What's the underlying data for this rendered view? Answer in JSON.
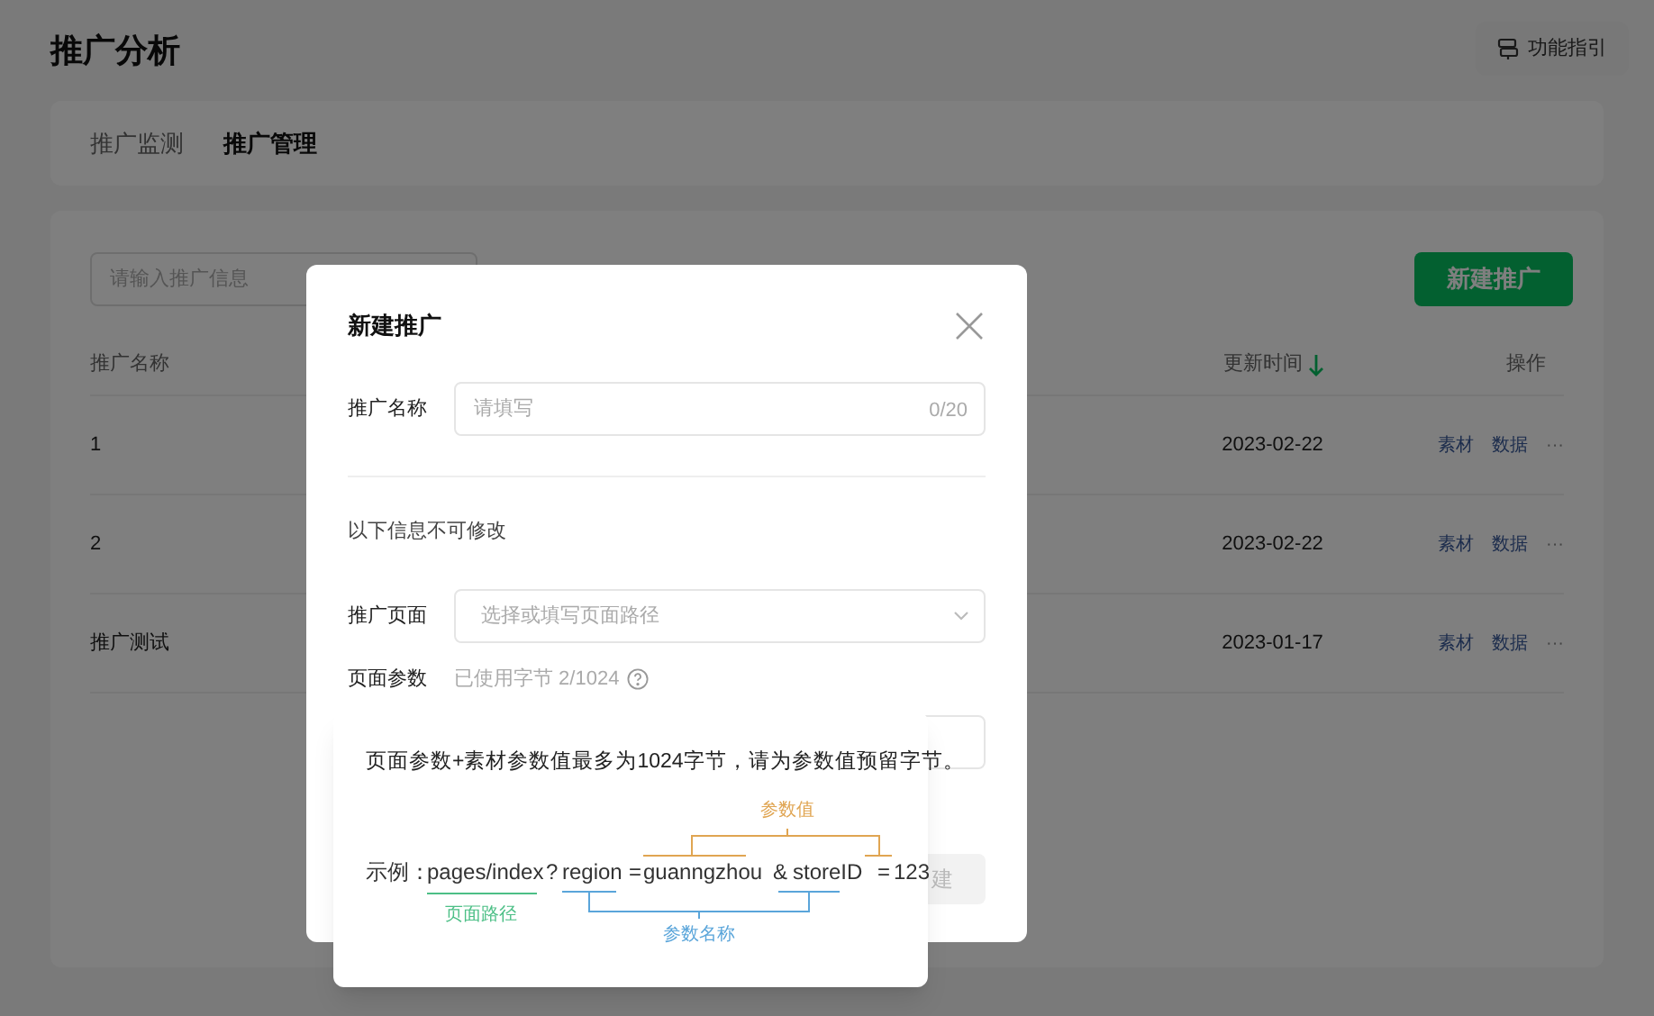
{
  "page": {
    "title": "推广分析",
    "guide_button": "功能指引"
  },
  "tabs": [
    {
      "label": "推广监测",
      "selected": false
    },
    {
      "label": "推广管理",
      "selected": true
    }
  ],
  "search": {
    "placeholder": "请输入推广信息"
  },
  "new_button": "新建推广",
  "table": {
    "columns": [
      {
        "label": "推广名称",
        "sorted_desc": false
      },
      {
        "label": "更新时间",
        "sorted_desc": true
      },
      {
        "label": "操作",
        "sorted_desc": false
      }
    ],
    "rows": [
      {
        "name": "1",
        "updated": "2023-02-22",
        "actions": [
          "素材",
          "数据",
          "···"
        ]
      },
      {
        "name": "2",
        "updated": "2023-02-22",
        "actions": [
          "素材",
          "数据",
          "···"
        ]
      },
      {
        "name": "推广测试",
        "updated": "2023-01-17",
        "actions": [
          "素材",
          "数据",
          "···"
        ]
      }
    ]
  },
  "dialog": {
    "title": "新建推广",
    "name_field": {
      "label": "推广名称",
      "placeholder": "请填写",
      "counter": "0/20"
    },
    "notice": "以下信息不可修改",
    "page_field": {
      "label": "推广页面",
      "placeholder": "选择或填写页面路径"
    },
    "params": {
      "label": "页面参数",
      "usage": "已使用字节 2/1024"
    },
    "button_fragment": "建"
  },
  "tooltip": {
    "text": "页面参数+素材参数值最多为1024字节，请为参数值预留字节。",
    "example_label": "示例：",
    "segments": [
      "pages/index",
      "?",
      "region",
      "=",
      "guanngzhou",
      "&",
      "storeID",
      "=",
      "123"
    ],
    "annotations": [
      {
        "text": "参数值",
        "color": "#e0a552"
      },
      {
        "text": "页面路径",
        "color": "#4cbf86"
      },
      {
        "text": "参数名称",
        "color": "#5aa5da"
      }
    ]
  }
}
